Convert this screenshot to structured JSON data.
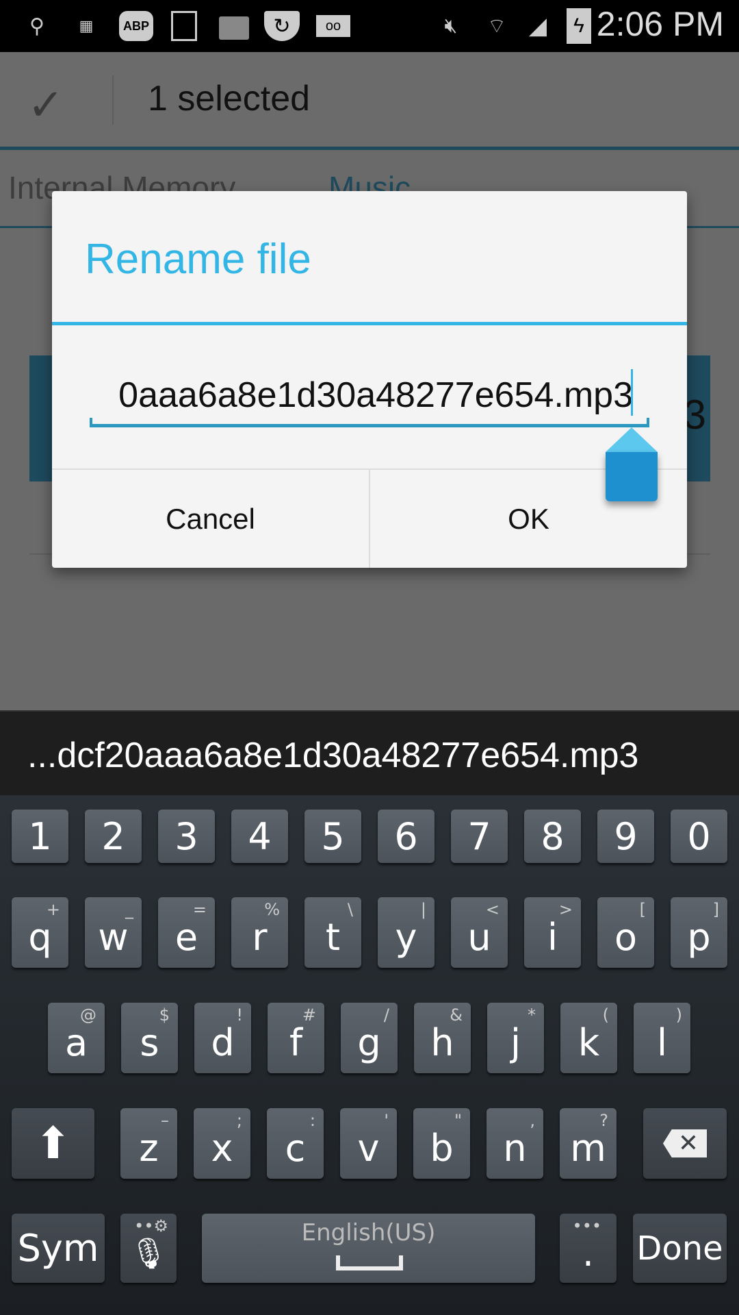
{
  "status_bar": {
    "time": "2:06 PM",
    "left_icons": [
      "usb-icon",
      "keyboard-icon",
      "adblock-icon",
      "gallery-icon",
      "folder-icon",
      "shield-update-icon",
      "voicemail-icon"
    ],
    "right_icons": [
      "mute-icon",
      "wifi-icon",
      "signal-icon",
      "battery-charging-icon"
    ],
    "abp_label": "ABP"
  },
  "action_bar": {
    "selected_label": "1 selected"
  },
  "tabs": [
    {
      "label": "Internal Memory",
      "active": false
    },
    {
      "label": "Music",
      "active": true
    }
  ],
  "list": {
    "item_size_partial": "3"
  },
  "dialog": {
    "title": "Rename file",
    "input_value": "0aaa6a8e1d30a48277e654.mp3",
    "cancel_label": "Cancel",
    "ok_label": "OK"
  },
  "keyboard": {
    "preview_text": "...dcf20aaa6a8e1d30a48277e654.mp3",
    "rows": [
      [
        {
          "label": "1"
        },
        {
          "label": "2"
        },
        {
          "label": "3"
        },
        {
          "label": "4"
        },
        {
          "label": "5"
        },
        {
          "label": "6"
        },
        {
          "label": "7"
        },
        {
          "label": "8"
        },
        {
          "label": "9"
        },
        {
          "label": "0"
        }
      ],
      [
        {
          "label": "q",
          "sub": "+"
        },
        {
          "label": "w",
          "sub": "_"
        },
        {
          "label": "e",
          "sub": "="
        },
        {
          "label": "r",
          "sub": "%"
        },
        {
          "label": "t",
          "sub": "\\"
        },
        {
          "label": "y",
          "sub": "|"
        },
        {
          "label": "u",
          "sub": "<"
        },
        {
          "label": "i",
          "sub": ">"
        },
        {
          "label": "o",
          "sub": "["
        },
        {
          "label": "p",
          "sub": "]"
        }
      ],
      [
        {
          "label": "a",
          "sub": "@"
        },
        {
          "label": "s",
          "sub": "$"
        },
        {
          "label": "d",
          "sub": "!"
        },
        {
          "label": "f",
          "sub": "#"
        },
        {
          "label": "g",
          "sub": "/"
        },
        {
          "label": "h",
          "sub": "&"
        },
        {
          "label": "j",
          "sub": "*"
        },
        {
          "label": "k",
          "sub": "("
        },
        {
          "label": "l",
          "sub": ")"
        }
      ],
      [
        {
          "label": "z",
          "sub": "–"
        },
        {
          "label": "x",
          "sub": ";"
        },
        {
          "label": "c",
          "sub": ":"
        },
        {
          "label": "v",
          "sub": "'"
        },
        {
          "label": "b",
          "sub": "\""
        },
        {
          "label": "n",
          "sub": ","
        },
        {
          "label": "m",
          "sub": "?"
        }
      ]
    ],
    "shift_icon": "shift-arrow-icon",
    "backspace_icon": "backspace-icon",
    "sym_label": "Sym",
    "mic_icon": "microphone-icon",
    "space_label": "English(US)",
    "period_label": ".",
    "done_label": "Done"
  },
  "colors": {
    "accent": "#33b5e5",
    "handle": "#1e90d0",
    "key": "#555c64",
    "keyboard_bg": "#1b1f23"
  }
}
